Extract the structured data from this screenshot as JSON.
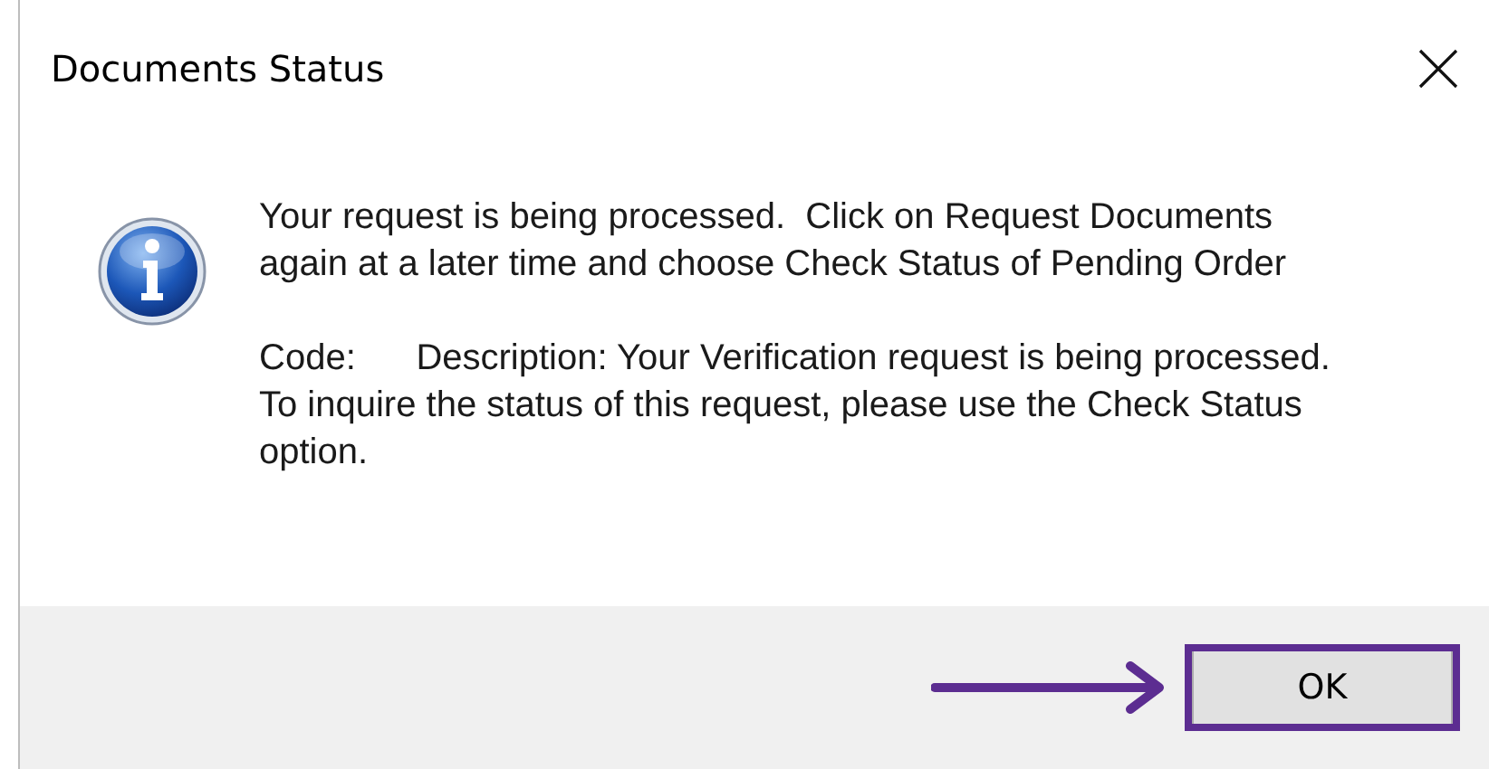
{
  "window": {
    "title": "Documents Status"
  },
  "message": {
    "paragraphs": [
      "Your request is being processed.  Click on Request Documents again at a later time and choose Check Status of Pending Order",
      "Code:      Description: Your Verification request is being processed. To inquire the status of this request, please use the Check Status option."
    ]
  },
  "buttons": [
    {
      "label": "OK",
      "highlighted": true
    }
  ]
}
